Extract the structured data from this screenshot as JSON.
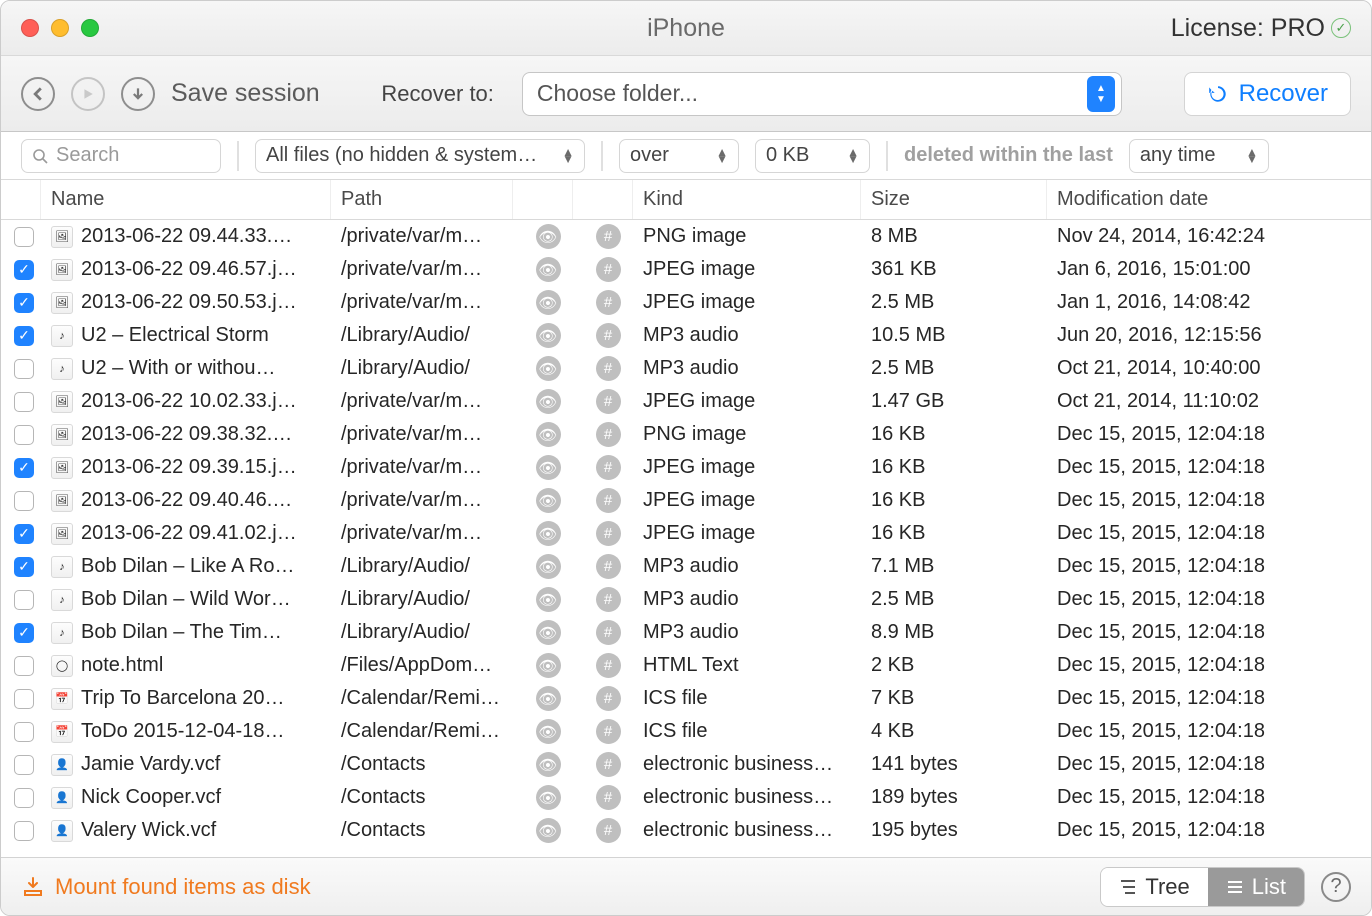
{
  "title": "iPhone",
  "license_label": "License: PRO",
  "toolbar": {
    "save_session": "Save session",
    "recover_to_label": "Recover to:",
    "folder_placeholder": "Choose folder...",
    "recover_button": "Recover"
  },
  "filters": {
    "search_placeholder": "Search",
    "file_filter": "All files (no hidden & system…",
    "size_op": "over",
    "size_value": "0 KB",
    "date_label": "deleted within the last",
    "date_value": "any time"
  },
  "columns": {
    "name": "Name",
    "path": "Path",
    "kind": "Kind",
    "size": "Size",
    "modified": "Modification date"
  },
  "footer": {
    "mount": "Mount found items as disk",
    "tree": "Tree",
    "list": "List"
  },
  "files": [
    {
      "checked": false,
      "icon": "image",
      "name": "2013-06-22 09.44.33.…",
      "path": "/private/var/m…",
      "kind": "PNG image",
      "size": "8 MB",
      "modified": "Nov 24, 2014, 16:42:24"
    },
    {
      "checked": true,
      "icon": "image",
      "name": "2013-06-22 09.46.57.j…",
      "path": "/private/var/m…",
      "kind": "JPEG image",
      "size": "361 KB",
      "modified": "Jan 6, 2016, 15:01:00"
    },
    {
      "checked": true,
      "icon": "image",
      "name": "2013-06-22 09.50.53.j…",
      "path": "/private/var/m…",
      "kind": "JPEG image",
      "size": "2.5 MB",
      "modified": "Jan 1, 2016, 14:08:42"
    },
    {
      "checked": true,
      "icon": "audio",
      "name": "U2 – Electrical Storm",
      "path": "/Library/Audio/",
      "kind": "MP3 audio",
      "size": "10.5 MB",
      "modified": "Jun 20, 2016, 12:15:56"
    },
    {
      "checked": false,
      "icon": "audio",
      "name": "U2 – With or withou…",
      "path": "/Library/Audio/",
      "kind": "MP3 audio",
      "size": "2.5 MB",
      "modified": "Oct 21, 2014, 10:40:00"
    },
    {
      "checked": false,
      "icon": "image",
      "name": "2013-06-22 10.02.33.j…",
      "path": "/private/var/m…",
      "kind": "JPEG image",
      "size": "1.47 GB",
      "modified": "Oct 21, 2014, 11:10:02"
    },
    {
      "checked": false,
      "icon": "image",
      "name": "2013-06-22 09.38.32.…",
      "path": "/private/var/m…",
      "kind": "PNG image",
      "size": "16 KB",
      "modified": "Dec 15, 2015, 12:04:18"
    },
    {
      "checked": true,
      "icon": "image",
      "name": "2013-06-22 09.39.15.j…",
      "path": "/private/var/m…",
      "kind": "JPEG image",
      "size": "16 KB",
      "modified": "Dec 15, 2015, 12:04:18"
    },
    {
      "checked": false,
      "icon": "image",
      "name": "2013-06-22 09.40.46.…",
      "path": "/private/var/m…",
      "kind": "JPEG image",
      "size": "16 KB",
      "modified": "Dec 15, 2015, 12:04:18"
    },
    {
      "checked": true,
      "icon": "image",
      "name": "2013-06-22 09.41.02.j…",
      "path": "/private/var/m…",
      "kind": "JPEG image",
      "size": "16 KB",
      "modified": "Dec 15, 2015, 12:04:18"
    },
    {
      "checked": true,
      "icon": "audio",
      "name": "Bob Dilan – Like A Ro…",
      "path": "/Library/Audio/",
      "kind": "MP3 audio",
      "size": "7.1 MB",
      "modified": "Dec 15, 2015, 12:04:18"
    },
    {
      "checked": false,
      "icon": "audio",
      "name": "Bob Dilan – Wild Wor…",
      "path": "/Library/Audio/",
      "kind": "MP3 audio",
      "size": "2.5 MB",
      "modified": "Dec 15, 2015, 12:04:18"
    },
    {
      "checked": true,
      "icon": "audio",
      "name": "Bob Dilan – The Tim…",
      "path": "/Library/Audio/",
      "kind": "MP3 audio",
      "size": "8.9 MB",
      "modified": "Dec 15, 2015, 12:04:18"
    },
    {
      "checked": false,
      "icon": "html",
      "name": "note.html",
      "path": "/Files/AppDom…",
      "kind": "HTML Text",
      "size": "2 KB",
      "modified": "Dec 15, 2015, 12:04:18"
    },
    {
      "checked": false,
      "icon": "cal",
      "name": "Trip To Barcelona 20…",
      "path": "/Calendar/Remi…",
      "kind": "ICS file",
      "size": "7 KB",
      "modified": "Dec 15, 2015, 12:04:18"
    },
    {
      "checked": false,
      "icon": "cal",
      "name": "ToDo 2015-12-04-18…",
      "path": "/Calendar/Remi…",
      "kind": "ICS file",
      "size": "4 KB",
      "modified": "Dec 15, 2015, 12:04:18"
    },
    {
      "checked": false,
      "icon": "vcf",
      "name": "Jamie Vardy.vcf",
      "path": "/Contacts",
      "kind": "electronic business…",
      "size": "141 bytes",
      "modified": "Dec 15, 2015, 12:04:18"
    },
    {
      "checked": false,
      "icon": "vcf",
      "name": "Nick Cooper.vcf",
      "path": "/Contacts",
      "kind": "electronic business…",
      "size": "189 bytes",
      "modified": "Dec 15, 2015, 12:04:18"
    },
    {
      "checked": false,
      "icon": "vcf",
      "name": "Valery Wick.vcf",
      "path": "/Contacts",
      "kind": "electronic business…",
      "size": "195 bytes",
      "modified": "Dec 15, 2015, 12:04:18"
    }
  ]
}
